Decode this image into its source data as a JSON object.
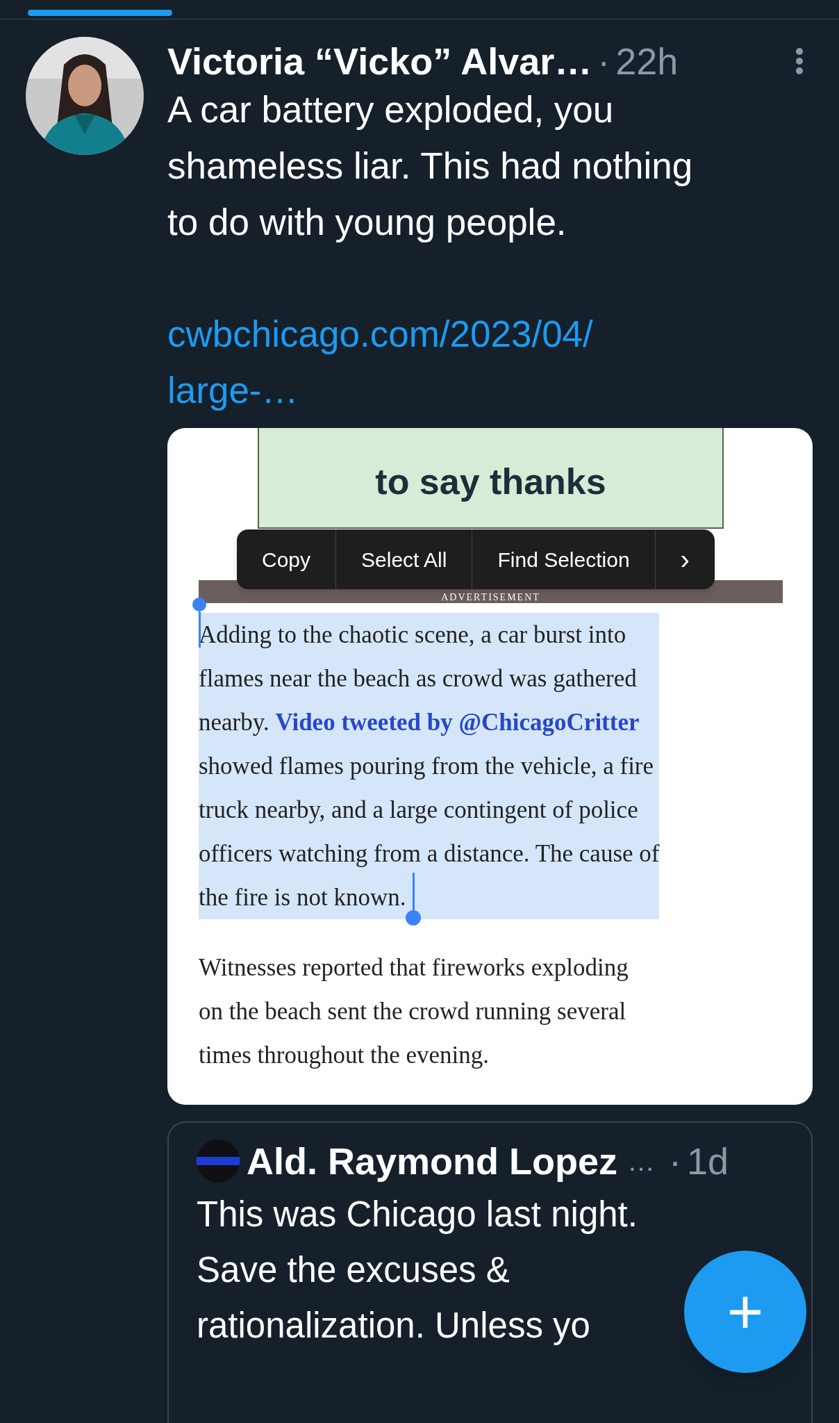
{
  "tweet": {
    "author": "Victoria “Vicko” Alvar…",
    "separator": "·",
    "time": "22h",
    "text_lines": [
      "A car battery exploded, you",
      "shameless liar. This had nothing",
      "to do with young people."
    ],
    "link": [
      "cwbchicago.com/2023/04/",
      "large-…"
    ]
  },
  "screenshot": {
    "heading": "to say thanks",
    "ad_label": "ADVERTISEMENT",
    "menu": [
      {
        "label": "Copy"
      },
      {
        "label": "Select All"
      },
      {
        "label": "Find Selection"
      },
      {
        "label": "›"
      }
    ],
    "paragraphs": [
      {
        "selected": true,
        "lines": [
          {
            "text": "Adding to the chaotic scene, a car burst into"
          },
          {
            "text": "flames near the beach as crowd was gathered"
          },
          {
            "text": "nearby.",
            "link": "Video tweeted by @ChicagoCritter"
          },
          {
            "text": "showed flames pouring from the vehicle, a fire"
          },
          {
            "text": "truck nearby, and a large contingent of police"
          },
          {
            "text": "officers watching from a distance. The cause of"
          },
          {
            "text": "the fire is not known."
          }
        ]
      },
      {
        "selected": false,
        "lines": [
          {
            "text": "Witnesses reported that fireworks exploding"
          },
          {
            "text": "on the beach sent the crowd running several"
          },
          {
            "text": "times throughout the evening."
          }
        ]
      }
    ]
  },
  "quote": {
    "author": "Ald. Raymond Lopez",
    "ellipsis": "…",
    "separator": "·",
    "time": "1d",
    "text_lines": [
      "This was Chicago last night.",
      "Save the excuses &",
      "rationalization. Unless yo"
    ]
  },
  "fab": {
    "label": "+"
  }
}
